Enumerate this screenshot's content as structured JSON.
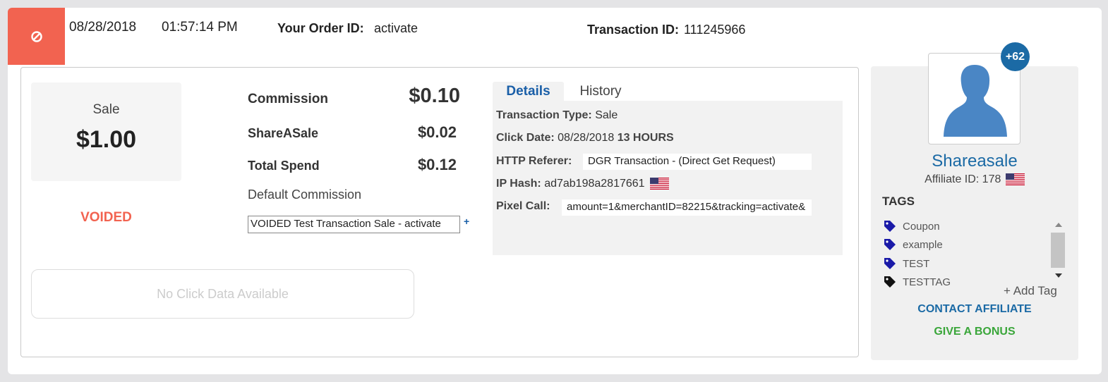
{
  "header": {
    "date": "08/28/2018",
    "time": "01:57:14 PM",
    "order_id_label": "Your Order ID:",
    "order_id": "activate",
    "transaction_id_label": "Transaction ID:",
    "transaction_id": "111245966",
    "void_icon": "void-circle-slash-icon",
    "void_color": "#f26350"
  },
  "sale": {
    "label": "Sale",
    "amount": "$1.00",
    "status": "VOIDED"
  },
  "commission": {
    "commission_label": "Commission",
    "commission_value": "$0.10",
    "shareasale_label": "ShareASale",
    "shareasale_value": "$0.02",
    "total_label": "Total Spend",
    "total_value": "$0.12",
    "default_label": "Default Commission",
    "note_value": "VOIDED Test Transaction Sale - activate",
    "add_symbol": "+"
  },
  "click_data": {
    "empty_text": "No Click Data Available"
  },
  "tabs": [
    {
      "label": "Details",
      "active": true
    },
    {
      "label": "History",
      "active": false
    }
  ],
  "details": {
    "type_label": "Transaction Type:",
    "type_value": "Sale",
    "click_label": "Click Date:",
    "click_value": "08/28/2018",
    "click_hours": "13 HOURS",
    "referer_label": "HTTP Referer:",
    "referer_value": "DGR Transaction - (Direct Get Request)",
    "ip_label": "IP Hash:",
    "ip_value": "ad7ab198a2817661",
    "pixel_label": "Pixel Call:",
    "pixel_value": "amount=1&merchantID=82215&tracking=activate&"
  },
  "affiliate": {
    "badge": "+62",
    "name": "Shareasale",
    "id_text": "Affiliate ID: 178",
    "avatar_icon": "person-silhouette-icon",
    "accent": "#1b6aa5"
  },
  "tags": {
    "title": "TAGS",
    "items": [
      {
        "label": "Coupon",
        "color": "#1a1aa8"
      },
      {
        "label": "example",
        "color": "#1a1aa8"
      },
      {
        "label": "TEST",
        "color": "#1a1aa8"
      },
      {
        "label": "TESTTAG",
        "color": "#111111"
      }
    ],
    "add_label": "+ Add Tag"
  },
  "actions": {
    "contact": "CONTACT AFFILIATE",
    "bonus": "GIVE A BONUS"
  }
}
